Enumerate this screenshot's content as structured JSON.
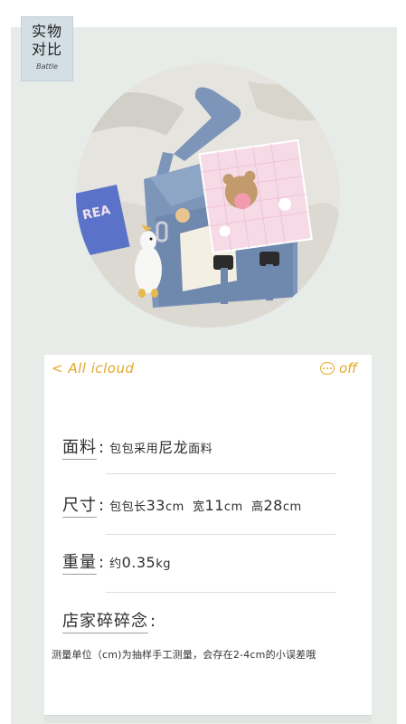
{
  "tag": {
    "line1": "实物",
    "line2": "对比",
    "line3": "Battle"
  },
  "photo": {
    "label": "product photo: blue canvas messenger bag"
  },
  "nav": {
    "back_label": "< All icloud",
    "right_label": "off"
  },
  "specs": [
    {
      "label": "面料",
      "value_parts": [
        {
          "text": "包包采用",
          "big": false
        },
        {
          "text": "尼龙",
          "big": true
        },
        {
          "text": "面料",
          "big": false
        }
      ]
    },
    {
      "label": "尺寸",
      "value_parts": [
        {
          "text": "包包长",
          "big": false
        },
        {
          "text": "33",
          "big": true
        },
        {
          "text": "cm  宽",
          "big": false
        },
        {
          "text": "11",
          "big": true
        },
        {
          "text": "cm  高",
          "big": false
        },
        {
          "text": "28",
          "big": true
        },
        {
          "text": "cm",
          "big": false
        }
      ]
    },
    {
      "label": "重量",
      "value_parts": [
        {
          "text": "约",
          "big": false
        },
        {
          "text": "0.35",
          "big": true
        },
        {
          "text": "kg",
          "big": false
        }
      ]
    },
    {
      "label": "店家碎碎念",
      "value_parts": []
    }
  ],
  "note": "测量单位（cm)为抽样手工测量，会存在2-4cm的小误差哦",
  "colors": {
    "accent": "#e0a92a",
    "panel": "#e7ece8",
    "tag_bg": "#d3dfe5",
    "bag_blue": "#7d95b8"
  }
}
